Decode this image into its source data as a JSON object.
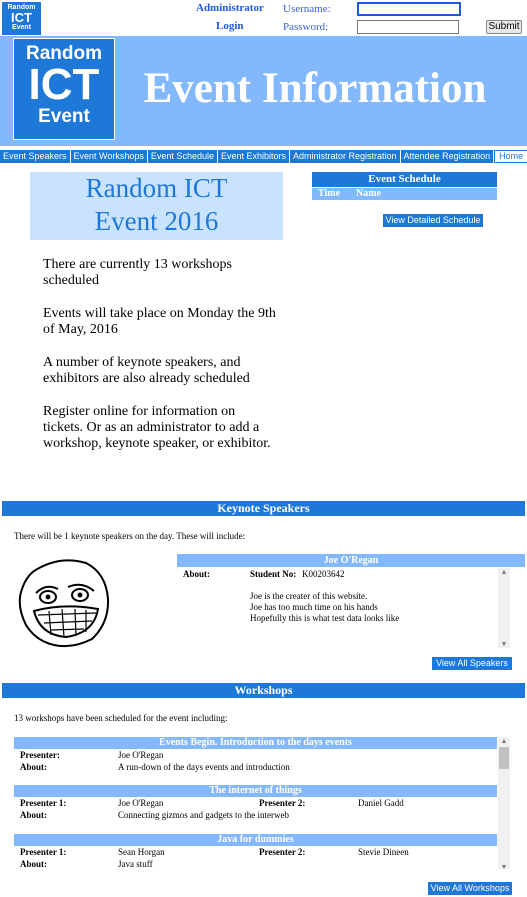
{
  "logo_small": {
    "line1": "Random",
    "line2": "ICT",
    "line3": "Event"
  },
  "login": {
    "administrator_label": "Administrator",
    "login_label": "Login",
    "username_label": "Username:",
    "password_label": "Password:",
    "submit_label": "Submit"
  },
  "banner": {
    "logo": {
      "line1": "Random",
      "line2": "ICT",
      "line3": "Event"
    },
    "title": "Event Information"
  },
  "nav": [
    "Event Speakers",
    "Event Workshops",
    "Event Schedule",
    "Event Exhibitors",
    "Administrator Registration",
    "Attendee Registration",
    "Home"
  ],
  "intro": {
    "event_title_1": "Random ICT",
    "event_title_2": "Event 2016",
    "paragraphs": [
      "There are currently 13 workshops scheduled",
      "Events will take place on Monday the 9th of May, 2016",
      "A number of keynote speakers, and exhibitors are also already scheduled",
      "Register online for information on tickets. Or as an administrator to add a workshop, keynote speaker, or exhibitor."
    ]
  },
  "schedule": {
    "heading": "Event Schedule",
    "col_time": "Time",
    "col_name": "Name",
    "button": "View Detailed Schedule"
  },
  "speakers": {
    "heading": "Keynote Speakers",
    "intro": "There will be 1 keynote speakers on the day. These will include:",
    "speaker_name": "Joe O'Regan",
    "about_label": "About:",
    "student_no_label": "Student No:",
    "student_no": "K00203642",
    "lines": [
      "Joe is the creater of this website.",
      "Joe has too much time on his hands",
      "Hopefully this is what test data looks like"
    ],
    "button": "View All Speakers"
  },
  "workshops": {
    "heading": "Workshops",
    "intro": "13 workshops have been scheduled for the event including:",
    "items": [
      {
        "title": "Events Begin. Introduction to the days events",
        "presenter_label": "Presenter:",
        "presenter": "Joe O'Regan",
        "about_label": "About:",
        "about": "A run-down of the days events and introduction"
      },
      {
        "title": "The internet of things",
        "presenter_label": "Presenter 1:",
        "presenter": "Joe O'Regan",
        "presenter2_label": "Presenter 2:",
        "presenter2": "Daniel Gadd",
        "about_label": "About:",
        "about": "Connecting gizmos and gadgets to the interweb"
      },
      {
        "title": "Java for dummies",
        "presenter_label": "Presenter 1:",
        "presenter": "Sean Horgan",
        "presenter2_label": "Presenter 2:",
        "presenter2": "Stevie Dineen",
        "about_label": "About:",
        "about": "Java stuff"
      }
    ],
    "button": "View All Workshops"
  },
  "colors": {
    "primary": "#1e78d8",
    "light": "#84b8fc",
    "pale": "#c9e2fd"
  },
  "icons": {
    "speaker_image": "trollface-image"
  }
}
